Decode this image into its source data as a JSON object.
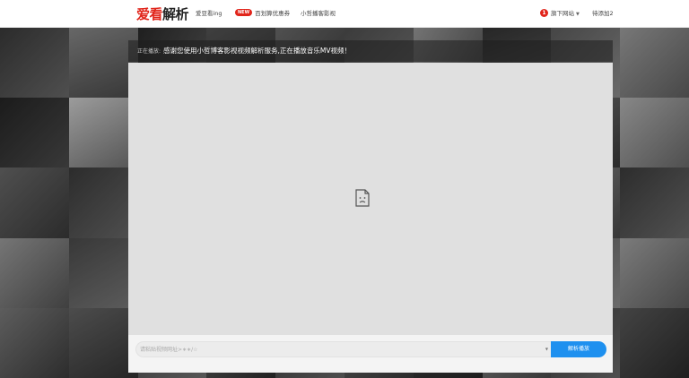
{
  "header": {
    "logo_red": "爱看",
    "logo_dark": "解析",
    "nav": [
      {
        "label": "爱豆看ing"
      },
      {
        "badge": "NEW",
        "label": "百划算优惠券"
      },
      {
        "label": "小哲播客影视"
      }
    ],
    "right": [
      {
        "badge": "1",
        "label": "旗下网站",
        "caret": "▼"
      },
      {
        "label": "待添加2"
      }
    ]
  },
  "player": {
    "now_playing_label": "正在播放:",
    "now_playing_text": "感谢您使用小哲博客影视视频解析服务,正在播放音乐MV视频！",
    "broken_icon": "broken-page-icon"
  },
  "controls": {
    "url_placeholder": "请粘贴视频网址>∗∗/☆",
    "select_caret": "▼",
    "parse_label": "解析播放"
  },
  "colors": {
    "brand_red": "#e1251b",
    "accent_blue": "#1e90ef"
  }
}
